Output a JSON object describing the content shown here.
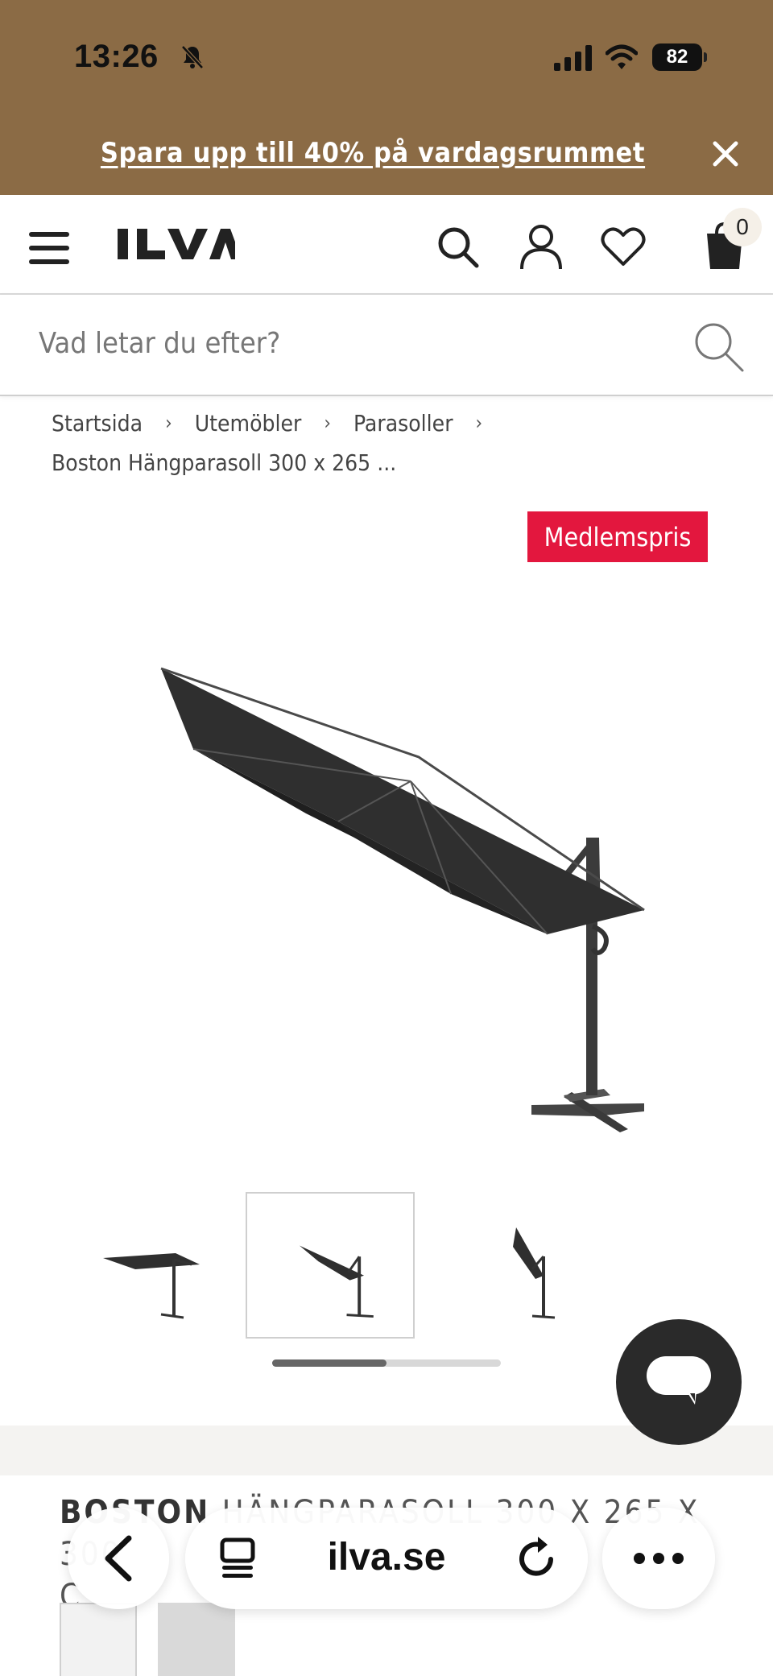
{
  "status_bar": {
    "time": "13:26",
    "battery": "82",
    "icons": [
      "bell-off-icon",
      "signal-icon",
      "wifi-icon",
      "battery-icon"
    ]
  },
  "promo": {
    "text": "Spara upp till 40% på vardagsrummet",
    "background": "#8b6b45"
  },
  "header": {
    "logo": "ILVA",
    "cart_count": "0",
    "icons": [
      "menu-icon",
      "search-icon",
      "user-icon",
      "heart-icon",
      "bag-icon"
    ]
  },
  "search": {
    "placeholder": "Vad letar du efter?"
  },
  "breadcrumb": {
    "items": [
      "Startsida",
      "Utemöbler",
      "Parasoller"
    ],
    "current": "Boston Hängparasoll 300 x 265 ..."
  },
  "badge": {
    "label": "Medlemspris",
    "color": "#e3173e"
  },
  "gallery": {
    "thumbnails": 3,
    "selected_index": 2,
    "scroll_progress": 0.5
  },
  "product": {
    "brand": "BOSTON",
    "title_rest": "HÄNGPARASOLL 300 X 265 X 300",
    "title_line2": "C"
  },
  "browser": {
    "url": "ilva.se"
  }
}
